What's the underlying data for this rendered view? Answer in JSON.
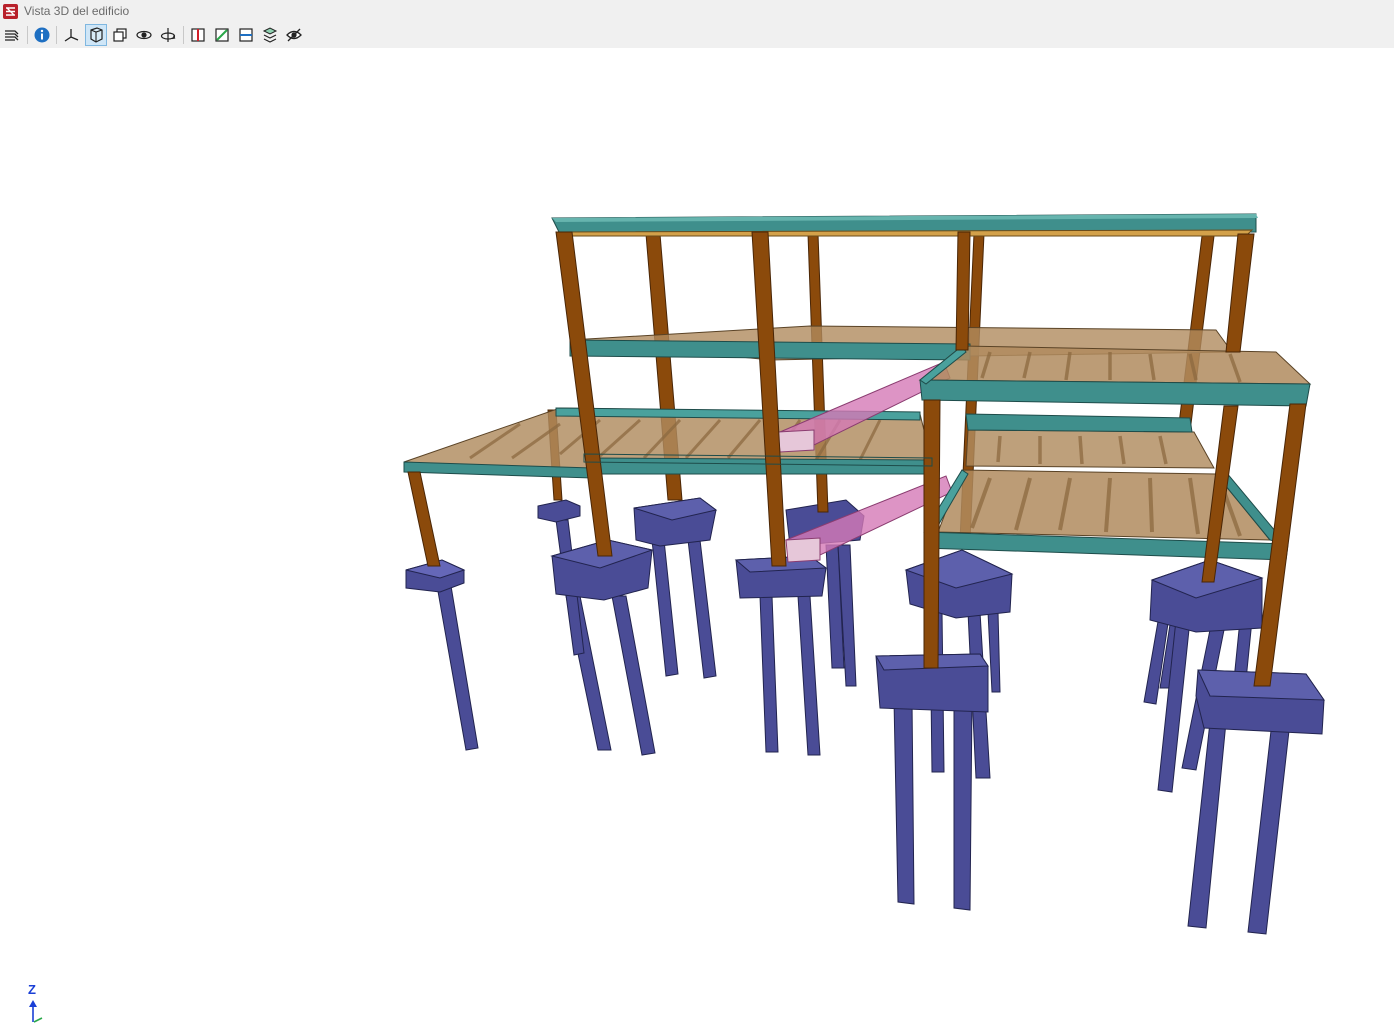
{
  "window": {
    "title": "Vista 3D del edificio",
    "app_icon": "app-logo-icon",
    "background": "#f0f0f0"
  },
  "toolbar": {
    "buttons": [
      {
        "name": "layers-button",
        "icon": "layers-icon",
        "active": false
      },
      {
        "name": "info-button",
        "icon": "info-icon",
        "active": false
      },
      {
        "name": "axes-button",
        "icon": "axes-icon",
        "active": false
      },
      {
        "name": "solid-view-button",
        "icon": "solid-view-icon",
        "active": true
      },
      {
        "name": "copy-view-button",
        "icon": "copy-view-icon",
        "active": false
      },
      {
        "name": "pan-view-button",
        "icon": "pan-view-icon",
        "active": false
      },
      {
        "name": "rotate-view-button",
        "icon": "rotate-view-icon",
        "active": false
      },
      {
        "name": "section-button",
        "icon": "section-icon",
        "active": false
      },
      {
        "name": "plane-button",
        "icon": "plane-icon",
        "active": false
      },
      {
        "name": "elevation-button",
        "icon": "elevation-icon",
        "active": false
      },
      {
        "name": "floors-button",
        "icon": "floors-icon",
        "active": false
      },
      {
        "name": "visibility-button",
        "icon": "eye-icon",
        "active": false
      }
    ]
  },
  "viewport": {
    "axis_label": "Z",
    "colors": {
      "columns": "#8b4a0b",
      "beams": "#3f8f8c",
      "slabs": "#b08b5e",
      "foundations": "#4a4c96",
      "stairs": "#d479b6",
      "accent": "#1a3fd6"
    }
  }
}
